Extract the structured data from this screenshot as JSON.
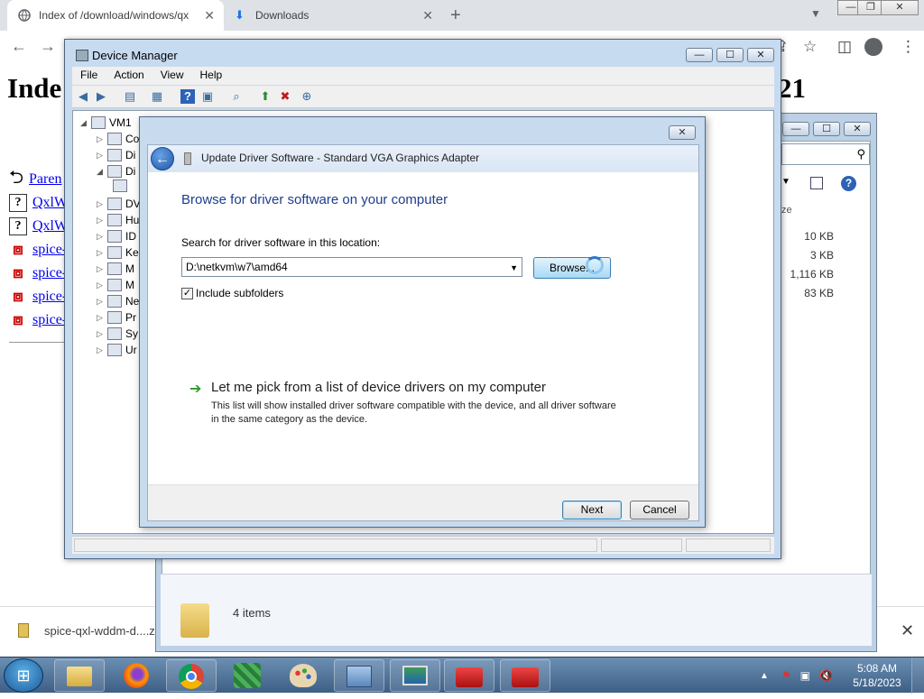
{
  "browser": {
    "tabs": [
      {
        "title": "Index of /download/windows/qx",
        "icon": "globe-icon"
      },
      {
        "title": "Downloads",
        "icon": "download-icon"
      }
    ],
    "new_tab": "+",
    "page_heading_left": "Inde",
    "page_heading_right": "21",
    "file_links": [
      {
        "label": "Paren",
        "icon": "back-arrow-icon"
      },
      {
        "label": "QxlW",
        "icon": "unknown-file-icon"
      },
      {
        "label": "QxlW",
        "icon": "unknown-file-icon"
      },
      {
        "label": "spice-",
        "icon": "package-icon"
      },
      {
        "label": "spice-",
        "icon": "package-icon"
      },
      {
        "label": "spice-",
        "icon": "package-icon"
      },
      {
        "label": "spice-",
        "icon": "package-icon"
      }
    ],
    "download_bar": {
      "item_label": "spice-qxl-wddm-d....z",
      "close": "✕"
    }
  },
  "explorer": {
    "size_header": "ze",
    "sizes": [
      "10 KB",
      "3 KB",
      "1,116 KB",
      "83 KB"
    ],
    "status": "4 items"
  },
  "device_manager": {
    "title": "Device Manager",
    "menu": [
      "File",
      "Action",
      "View",
      "Help"
    ],
    "tree": [
      {
        "label": "VM1",
        "indent": 0,
        "arrow": "◢"
      },
      {
        "label": "Co",
        "indent": 1,
        "arrow": "▷"
      },
      {
        "label": "Di",
        "indent": 1,
        "arrow": "▷"
      },
      {
        "label": "Di",
        "indent": 1,
        "arrow": "◢"
      },
      {
        "label": "",
        "indent": 2,
        "arrow": ""
      },
      {
        "label": "DV",
        "indent": 1,
        "arrow": "▷"
      },
      {
        "label": "Hu",
        "indent": 1,
        "arrow": "▷"
      },
      {
        "label": "ID",
        "indent": 1,
        "arrow": "▷"
      },
      {
        "label": "Ke",
        "indent": 1,
        "arrow": "▷"
      },
      {
        "label": "M",
        "indent": 1,
        "arrow": "▷"
      },
      {
        "label": "M",
        "indent": 1,
        "arrow": "▷"
      },
      {
        "label": "Ne",
        "indent": 1,
        "arrow": "▷"
      },
      {
        "label": "Pr",
        "indent": 1,
        "arrow": "▷"
      },
      {
        "label": "Sy",
        "indent": 1,
        "arrow": "▷"
      },
      {
        "label": "Ur",
        "indent": 1,
        "arrow": "▷"
      }
    ]
  },
  "dialog": {
    "title": "Update Driver Software - Standard VGA Graphics Adapter",
    "heading": "Browse for driver software on your computer",
    "search_label": "Search for driver software in this location:",
    "path_value": "D:\\netkvm\\w7\\amd64",
    "browse_label": "Browse...",
    "include_subfolders_label": "Include subfolders",
    "include_subfolders_checked": true,
    "pick_link": "Let me pick from a list of device drivers on my computer",
    "pick_description": "This list will show installed driver software compatible with the device, and all driver software in the same category as the device.",
    "next_label": "Next",
    "cancel_label": "Cancel"
  },
  "taskbar": {
    "items": [
      "windows-explorer-icon",
      "firefox-icon",
      "chrome-icon",
      "network-icon",
      "paint-icon",
      "remote-desktop-icon",
      "monitor-icon",
      "toolbox-icon",
      "toolbox-icon"
    ],
    "clock_time": "5:08 AM",
    "clock_date": "5/18/2023"
  }
}
